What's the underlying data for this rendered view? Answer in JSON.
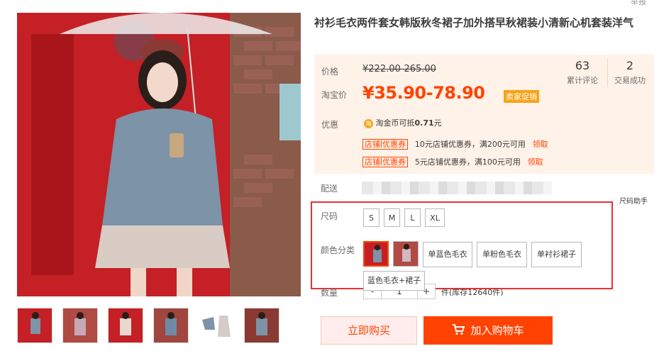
{
  "product": {
    "title": "衬衫毛衣两件套女韩版秋冬裙子加外搭早秋裙装小清新心机套装洋气",
    "report": "举报"
  },
  "price": {
    "label": "价格",
    "original": "¥222.00-265.00",
    "promo_label": "淘宝价",
    "promo": "¥35.90-78.90",
    "promo_tag": "卖家促销"
  },
  "stats": [
    {
      "num": "63",
      "label": "累计评论"
    },
    {
      "num": "2",
      "label": "交易成功"
    }
  ],
  "offers": {
    "label": "优惠",
    "coin_icon": "淘",
    "coin_text_pre": "淘金币可抵",
    "coin_amount": "0.71",
    "coin_text_post": "元",
    "coupons": [
      {
        "badge_a": "店铺",
        "badge_b": "优惠券",
        "text": "10元店铺优惠券，满200元可用",
        "link": "领取"
      },
      {
        "badge_a": "店铺",
        "badge_b": "优惠券",
        "text": "5元店铺优惠券，满100元可用",
        "link": "领取"
      }
    ]
  },
  "delivery": {
    "label": "配送"
  },
  "size": {
    "label": "尺码",
    "helper": "尺码助手",
    "options": [
      "S",
      "M",
      "L",
      "XL"
    ]
  },
  "color": {
    "label": "颜色分类",
    "text_options": [
      "单蓝色毛衣",
      "单粉色毛衣",
      "单衬衫裙子"
    ],
    "tooltip": "蓝色毛衣+裙子"
  },
  "quantity": {
    "label": "数量",
    "value": "1",
    "minus": "-",
    "plus": "+",
    "stock": "件(库存12640件)"
  },
  "actions": {
    "buy": "立即购买",
    "cart": "加入购物车"
  },
  "colors": {
    "accent": "#ff4400",
    "panel_bg": "#fff2e8",
    "highlight_box": "#e63232"
  }
}
